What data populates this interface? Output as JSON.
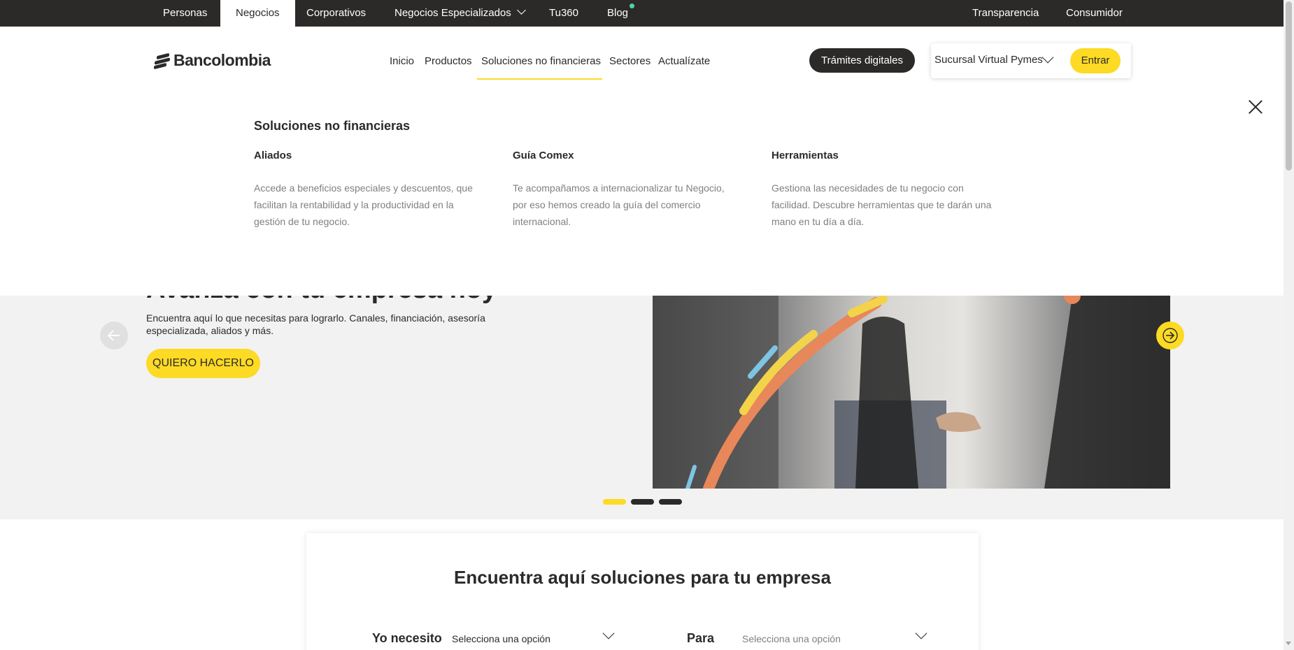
{
  "topbar": {
    "items": [
      "Personas",
      "Negocios",
      "Corporativos",
      "Negocios Especializados",
      "Tu360",
      "Blog"
    ],
    "right": [
      "Transparencia",
      "Consumidor"
    ]
  },
  "header": {
    "logo": "Bancolombia",
    "nav": [
      "Inicio",
      "Productos",
      "Soluciones no financieras",
      "Sectores",
      "Actualízate"
    ],
    "tramites_label": "Trámites digitales",
    "sucursal_label": "Sucursal Virtual Pymes",
    "entrar_label": "Entrar"
  },
  "mega_menu": {
    "title": "Soluciones no financieras",
    "columns": [
      {
        "title": "Aliados",
        "desc": "Accede a beneficios especiales y descuentos, que facilitan la rentabilidad y la productividad en la gestión de tu negocio."
      },
      {
        "title": "Guía Comex",
        "desc": "Te acompañamos a internacionalizar tu Negocio, por eso hemos creado la guía del comercio internacional."
      },
      {
        "title": "Herramientas",
        "desc": "Gestiona las necesidades de tu negocio con facilidad. Descubre herramientas que te darán una mano en tu día a día."
      }
    ]
  },
  "hero": {
    "title": "Avanza con tu empresa hoy",
    "desc": "Encuentra aquí lo que necesitas para lograrlo. Canales, financiación, asesoría especializada, aliados y más.",
    "cta": "QUIERO HACERLO",
    "active_slide": 1,
    "slide_count": 3
  },
  "finder": {
    "title": "Encuentra aquí soluciones para tu empresa",
    "need_label": "Yo necesito",
    "need_value": "Selecciona una opción",
    "for_label": "Para",
    "for_placeholder": "Selecciona una opción"
  },
  "colors": {
    "brand_yellow": "#fdda24",
    "dark": "#2c2a29",
    "hero_bg": "#f2f2f2"
  }
}
